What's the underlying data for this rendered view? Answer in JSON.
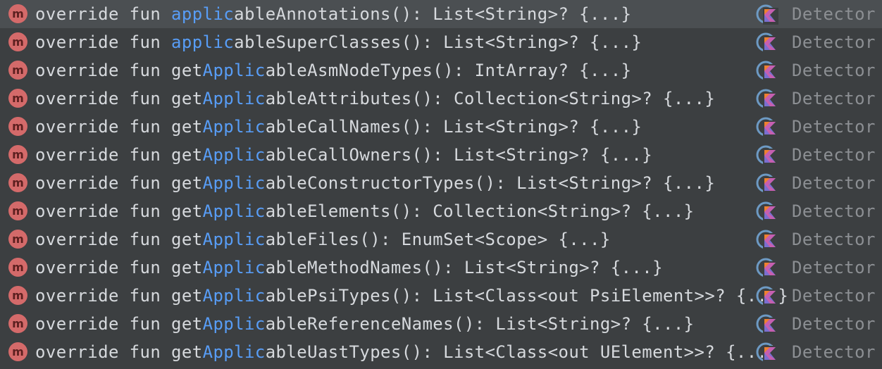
{
  "completion_list": {
    "items": [
      {
        "icon": "method-icon",
        "badge": "m",
        "prefix": "override fun ",
        "match": "applic",
        "suffix": "ableAnnotations(): List<String>? {...}",
        "class_icon": "kotlin-class-icon",
        "class_name": "Detector",
        "selected": true
      },
      {
        "icon": "method-icon",
        "badge": "m",
        "prefix": "override fun ",
        "match": "applic",
        "suffix": "ableSuperClasses(): List<String>? {...}",
        "class_icon": "kotlin-class-icon",
        "class_name": "Detector",
        "selected": false
      },
      {
        "icon": "method-icon",
        "badge": "m",
        "prefix": "override fun get",
        "match": "Applic",
        "suffix": "ableAsmNodeTypes(): IntArray? {...}",
        "class_icon": "kotlin-class-icon",
        "class_name": "Detector",
        "selected": false
      },
      {
        "icon": "method-icon",
        "badge": "m",
        "prefix": "override fun get",
        "match": "Applic",
        "suffix": "ableAttributes(): Collection<String>? {...}",
        "class_icon": "kotlin-class-icon",
        "class_name": "Detector",
        "selected": false
      },
      {
        "icon": "method-icon",
        "badge": "m",
        "prefix": "override fun get",
        "match": "Applic",
        "suffix": "ableCallNames(): List<String>? {...}",
        "class_icon": "kotlin-class-icon",
        "class_name": "Detector",
        "selected": false
      },
      {
        "icon": "method-icon",
        "badge": "m",
        "prefix": "override fun get",
        "match": "Applic",
        "suffix": "ableCallOwners(): List<String>? {...}",
        "class_icon": "kotlin-class-icon",
        "class_name": "Detector",
        "selected": false
      },
      {
        "icon": "method-icon",
        "badge": "m",
        "prefix": "override fun get",
        "match": "Applic",
        "suffix": "ableConstructorTypes(): List<String>? {...}",
        "class_icon": "kotlin-class-icon",
        "class_name": "Detector",
        "selected": false
      },
      {
        "icon": "method-icon",
        "badge": "m",
        "prefix": "override fun get",
        "match": "Applic",
        "suffix": "ableElements(): Collection<String>? {...}",
        "class_icon": "kotlin-class-icon",
        "class_name": "Detector",
        "selected": false
      },
      {
        "icon": "method-icon",
        "badge": "m",
        "prefix": "override fun get",
        "match": "Applic",
        "suffix": "ableFiles(): EnumSet<Scope> {...}",
        "class_icon": "kotlin-class-icon",
        "class_name": "Detector",
        "selected": false
      },
      {
        "icon": "method-icon",
        "badge": "m",
        "prefix": "override fun get",
        "match": "Applic",
        "suffix": "ableMethodNames(): List<String>? {...}",
        "class_icon": "kotlin-class-icon",
        "class_name": "Detector",
        "selected": false
      },
      {
        "icon": "method-icon",
        "badge": "m",
        "prefix": "override fun get",
        "match": "Applic",
        "suffix": "ablePsiTypes(): List<Class<out PsiElement>>? {...}",
        "class_icon": "kotlin-class-icon",
        "class_name": "Detector",
        "selected": false
      },
      {
        "icon": "method-icon",
        "badge": "m",
        "prefix": "override fun get",
        "match": "Applic",
        "suffix": "ableReferenceNames(): List<String>? {...}",
        "class_icon": "kotlin-class-icon",
        "class_name": "Detector",
        "selected": false
      },
      {
        "icon": "method-icon",
        "badge": "m",
        "prefix": "override fun get",
        "match": "Applic",
        "suffix": "ableUastTypes(): List<Class<out UElement>>? {...}",
        "class_icon": "kotlin-class-icon",
        "class_name": "Detector",
        "selected": false
      }
    ]
  },
  "colors": {
    "background": "#3c3f41",
    "selected_row": "#4b4f52",
    "text": "#d6d9dd",
    "match_highlight": "#589df6",
    "class_name": "#8c8f93",
    "method_badge": "#d46a6a"
  }
}
